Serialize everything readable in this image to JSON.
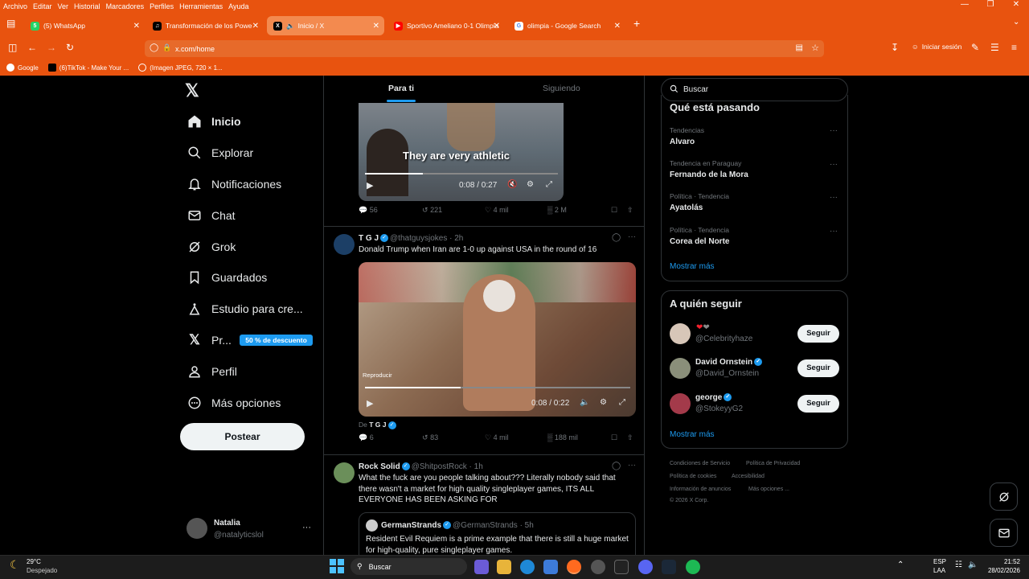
{
  "menubar": {
    "items": [
      "Archivo",
      "Editar",
      "Ver",
      "Historial",
      "Marcadores",
      "Perfiles",
      "Herramientas",
      "Ayuda"
    ]
  },
  "tabs": [
    {
      "label": "(5) WhatsApp",
      "icon": "whatsapp-icon",
      "color": "#25d366"
    },
    {
      "label": "Transformación de los Power R...",
      "icon": "tiktok-icon",
      "color": "#000000"
    },
    {
      "label": "Inicio / X",
      "icon": "x-icon",
      "color": "#000000"
    },
    {
      "label": "Sportivo Ameliano 0-1 Olimpia",
      "icon": "youtube-icon",
      "color": "#ff0000"
    },
    {
      "label": "olimpia - Google Search",
      "icon": "google-icon",
      "color": "#ffffff"
    }
  ],
  "toolbar": {
    "url": "x.com/home",
    "signin": "Iniciar sesión"
  },
  "bookmarks": [
    "Google",
    "(6)TikTok - Make Your ...",
    "(Imagen JPEG, 720 × 1..."
  ],
  "nav": {
    "items": [
      {
        "label": "Inicio",
        "icon": "home-icon"
      },
      {
        "label": "Explorar",
        "icon": "search-icon"
      },
      {
        "label": "Notificaciones",
        "icon": "bell-icon"
      },
      {
        "label": "Chat",
        "icon": "mail-icon"
      },
      {
        "label": "Grok",
        "icon": "grok-icon"
      },
      {
        "label": "Guardados",
        "icon": "bookmark-icon"
      },
      {
        "label": "Estudio para cre...",
        "icon": "studio-icon"
      },
      {
        "label": "Pr...",
        "icon": "x-premium-icon"
      },
      {
        "label": "Perfil",
        "icon": "person-icon"
      },
      {
        "label": "Más opciones",
        "icon": "more-circle-icon"
      }
    ],
    "promo": "50 % de descuento",
    "post_button": "Postear",
    "account": {
      "name": "Natalia",
      "handle": "@natalyticslol"
    }
  },
  "feed": {
    "tabs": [
      "Para ti",
      "Siguiendo"
    ],
    "post0": {
      "caption": "They are very athletic",
      "time": "0:08 / 0:27",
      "replies": "56",
      "reposts": "221",
      "likes": "4 mil",
      "views": "2 M"
    },
    "post1": {
      "name": "T G J",
      "handle": "@thatguysjokes",
      "age": "· 2h",
      "text": "Donald Trump when Iran are 1-0 up against USA in the round of 16",
      "overlay": "Reproducir",
      "time": "0:08 / 0:22",
      "from_label": "De",
      "from_name": "T G J",
      "replies": "6",
      "reposts": "83",
      "likes": "4 mil",
      "views": "188 mil"
    },
    "post2": {
      "name": "Rock Solid",
      "handle": "@ShitpostRock",
      "age": "· 1h",
      "text": "What the fuck are you people talking about??? Literally nobody said that there wasn't a market for high quality singleplayer games, ITS ALL EVERYONE HAS BEEN ASKING FOR",
      "quote": {
        "name": "GermanStrands",
        "handle": "@GermanStrands",
        "age": "· 5h",
        "text": "Resident Evil Requiem is a prime example that there is still a huge market for high-quality, pure singleplayer games."
      }
    }
  },
  "sidebar": {
    "search_placeholder": "Buscar",
    "trends_title": "Qué está pasando",
    "trends": [
      {
        "context": "Tendencias",
        "name": "Alvaro"
      },
      {
        "context": "Tendencia en Paraguay",
        "name": "Fernando de la Mora"
      },
      {
        "context": "Política · Tendencia",
        "name": "Ayatolás"
      },
      {
        "context": "Política · Tendencia",
        "name": "Corea del Norte"
      }
    ],
    "show_more": "Mostrar más",
    "follow_title": "A quién seguir",
    "follow": [
      {
        "name": "",
        "handle": "@Celebrityhaze",
        "button": "Seguir"
      },
      {
        "name": "David Ornstein",
        "handle": "@David_Ornstein",
        "button": "Seguir"
      },
      {
        "name": "george",
        "handle": "@StokeyyG2",
        "button": "Seguir"
      }
    ],
    "show_more2": "Mostrar más",
    "footer": [
      "Condiciones de Servicio",
      "Política de Privacidad",
      "Política de cookies",
      "Accesibilidad",
      "Información de anuncios",
      "Más opciones ...",
      "© 2026 X Corp."
    ]
  },
  "taskbar": {
    "weather_temp": "29°C",
    "weather_desc": "Despejado",
    "search": "Buscar",
    "lang": "ESP",
    "lang2": "LAA",
    "time": "21:52",
    "date": "28/02/2026"
  }
}
